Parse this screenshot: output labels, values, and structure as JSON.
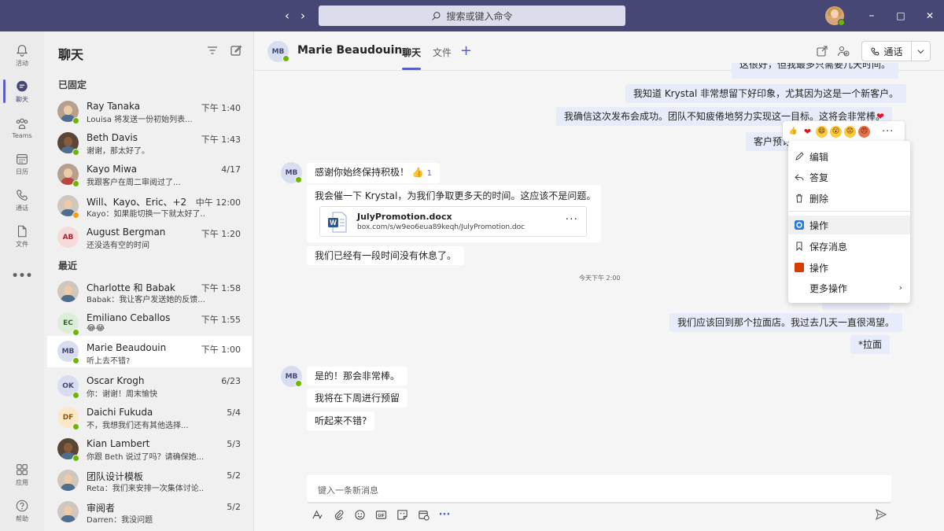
{
  "titlebar": {
    "back_icon": "chevron-left-icon",
    "forward_icon": "chevron-right-icon",
    "search_placeholder": "搜索或键入命令",
    "minimize": "–",
    "maximize": "□",
    "close": "✕"
  },
  "rail": [
    {
      "label": "活动",
      "icon": "bell-icon"
    },
    {
      "label": "聊天",
      "icon": "chat-icon"
    },
    {
      "label": "Teams",
      "icon": "teams-icon"
    },
    {
      "label": "日历",
      "icon": "calendar-icon"
    },
    {
      "label": "通话",
      "icon": "phone-icon"
    },
    {
      "label": "文件",
      "icon": "file-icon"
    },
    {
      "label": "•••",
      "icon": "more-icon"
    },
    {
      "label": "应用",
      "icon": "apps-icon"
    },
    {
      "label": "帮助",
      "icon": "help-icon"
    }
  ],
  "chat_list": {
    "title": "聊天",
    "pinned_label": "已固定",
    "recent_label": "最近",
    "pinned": [
      {
        "name": "Ray Tanaka",
        "time": "下午 1:40",
        "preview": "Louisa 将发送一份初始列表..."
      },
      {
        "name": "Beth Davis",
        "time": "下午 1:43",
        "preview": "谢谢，那太好了。"
      },
      {
        "name": "Kayo Miwa",
        "time": "4/17",
        "preview": "我跟客户在周二审阅过了..."
      },
      {
        "name": "Will、Kayo、Eric、+2",
        "time": "中午 12:00",
        "preview": "Kayo：如果能切换一下就太好了..."
      },
      {
        "name": "August Bergman",
        "time": "下午 1:20",
        "preview": "还没选有空的时间",
        "initials": "AB"
      }
    ],
    "recent": [
      {
        "name": "Charlotte 和 Babak",
        "time": "下午 1:58",
        "preview": "Babak：我让客户发送她的反馈..."
      },
      {
        "name": "Emiliano Ceballos",
        "time": "下午 1:55",
        "preview": "😂😂",
        "initials": "EC"
      },
      {
        "name": "Marie Beaudouin",
        "time": "下午 1:00",
        "preview": "听上去不错?",
        "initials": "MB"
      },
      {
        "name": "Oscar Krogh",
        "time": "6/23",
        "preview": "你：谢谢！周末愉快",
        "initials": "OK"
      },
      {
        "name": "Daichi Fukuda",
        "time": "5/4",
        "preview": "不，我想我们还有其他选择...",
        "initials": "DF"
      },
      {
        "name": "Kian Lambert",
        "time": "5/3",
        "preview": "你跟 Beth 说过了吗？请确保她..."
      },
      {
        "name": "团队设计模板",
        "time": "5/2",
        "preview": "Reta：我们来安排一次集体讨论..."
      },
      {
        "name": "审阅者",
        "time": "5/2",
        "preview": "Darren：我没问题"
      }
    ]
  },
  "conversation": {
    "contact_initials": "MB",
    "contact_name": "Marie Beaudouin",
    "tabs": [
      "聊天",
      "文件"
    ],
    "call_label": "通话",
    "messages_out_top": [
      "这很好，但我最多只需要几天时间。",
      "我知道 Krystal 非常想留下好印象，尤其因为这是一个新客户。",
      "我确信这次发布会成功。团队不知疲倦地努力实现这一目标。这将会非常棒。",
      "客户预订"
    ],
    "messages_in_1": {
      "first": "感谢你始终保持积极！",
      "reaction": "👍",
      "reaction_count": "1",
      "second": "我会催一下 Krystal，为我们争取更多天的时间。这应该不是问题。",
      "attachment_name": "JulyPromotion.docx",
      "attachment_url": "box.com/s/w9eo6eua89keqh/JulyPromotion.doc",
      "third": "我们已经有一段时间没有休息了。"
    },
    "timestamp": "今天下午 2:00",
    "messages_out_bottom": [
      "我们应该回到那个拉面店。我过去几天一直很渴望。",
      "*拉面"
    ],
    "messages_in_2": [
      "是的！那会非常棒。",
      "我将在下周进行预留",
      "听起来不错?"
    ],
    "compose_placeholder": "键入一条新消息"
  },
  "reactions": [
    "👍",
    "❤",
    "😄",
    "😮",
    "😟",
    "😠"
  ],
  "context_menu": {
    "items": [
      {
        "label": "编辑",
        "icon": "pencil-icon"
      },
      {
        "label": "答复",
        "icon": "reply-icon"
      },
      {
        "label": "删除",
        "icon": "trash-icon"
      },
      {
        "label": "操作",
        "icon": "action-circle-icon"
      },
      {
        "label": "保存消息",
        "icon": "bookmark-icon"
      },
      {
        "label": "操作",
        "icon": "office-icon"
      },
      {
        "label": "更多操作",
        "icon": "none"
      }
    ]
  },
  "colors": {
    "titlebar": "#464775",
    "accent": "#5b5fc7",
    "presence": "#6bb700",
    "reaction_heart": "#e81123",
    "word_blue": "#2b579a"
  }
}
